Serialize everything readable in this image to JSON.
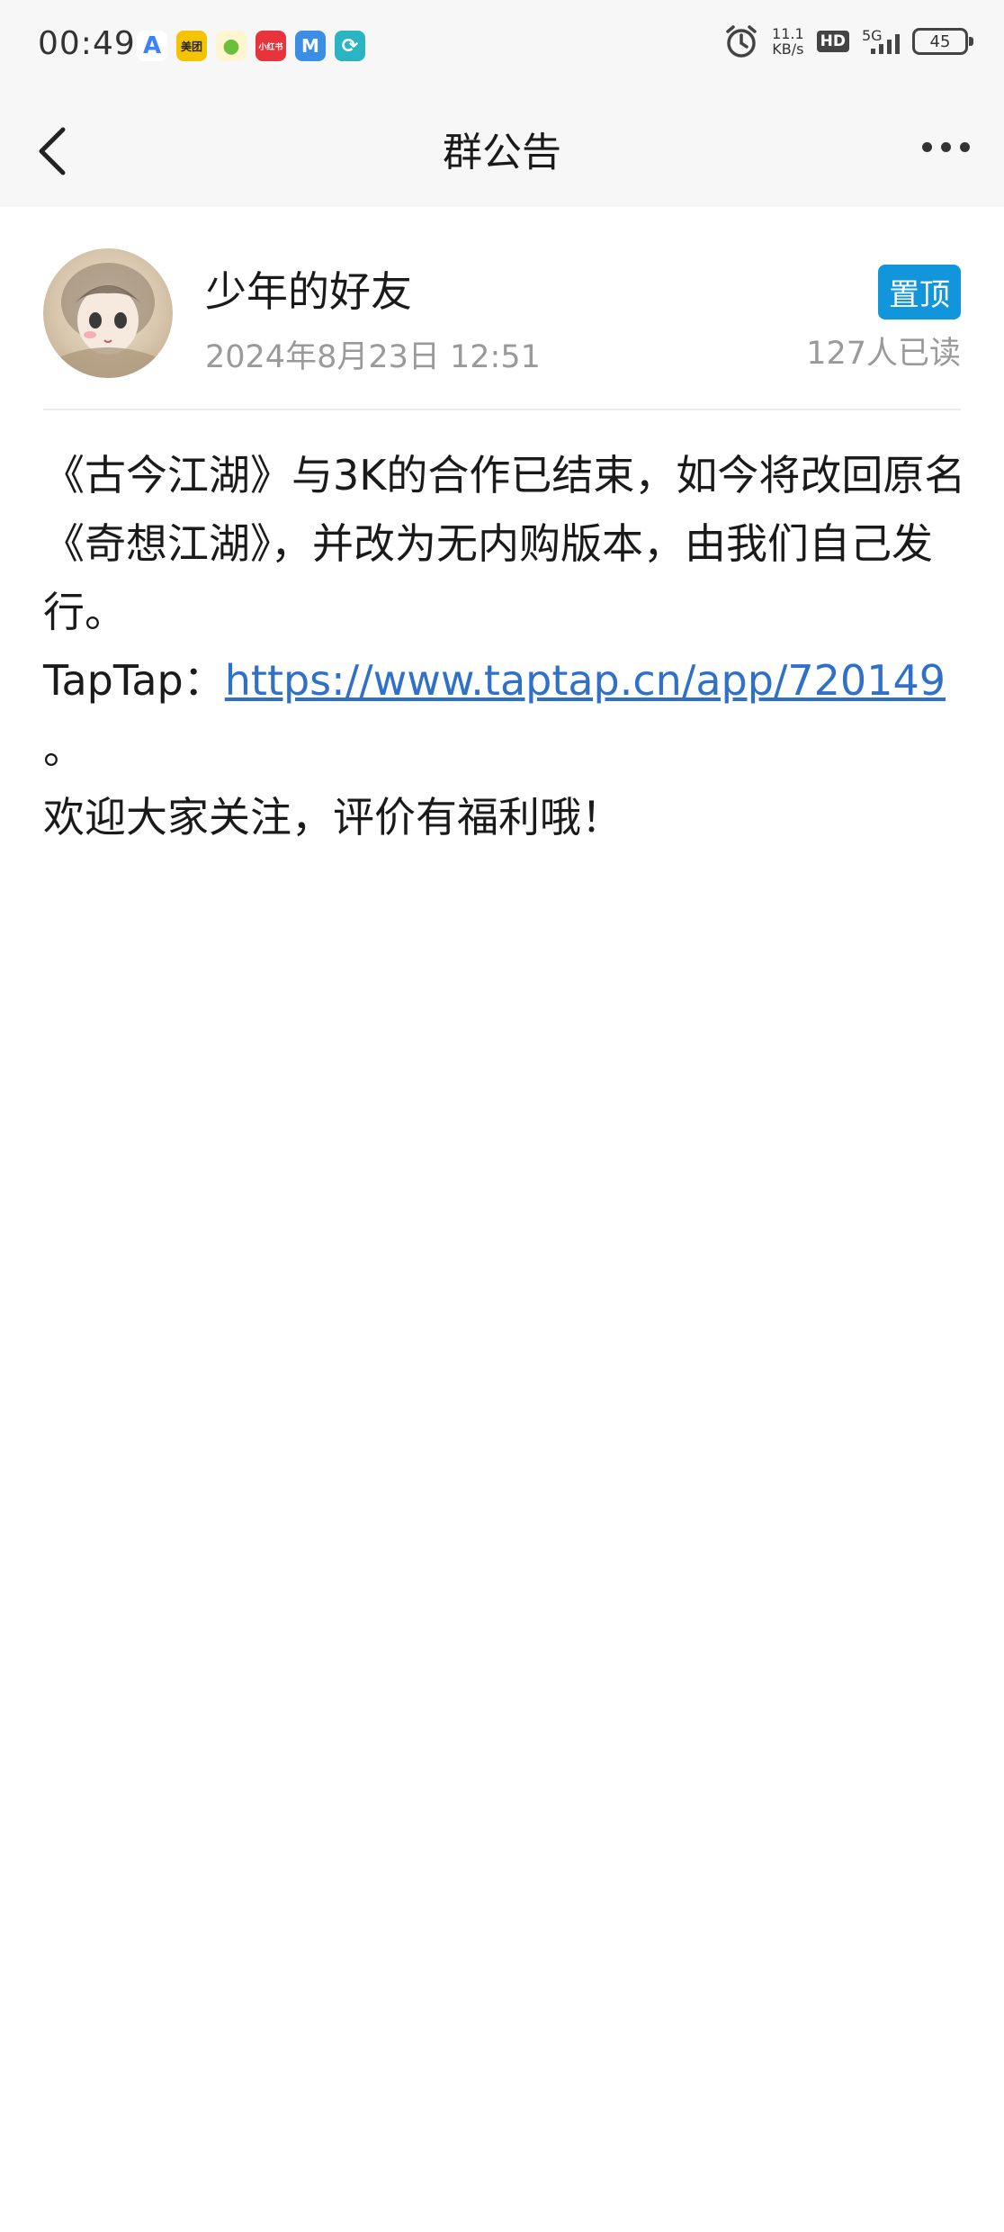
{
  "status": {
    "time": "00:49",
    "speed_value": "11.1",
    "speed_unit": "KB/s",
    "hd": "HD",
    "network": "5G",
    "battery": "45",
    "apps": [
      {
        "name": "app-a-icon",
        "glyph": "A",
        "color": "#3b82f6"
      },
      {
        "name": "meituan-icon",
        "glyph": "美团",
        "color": "#f5c400"
      },
      {
        "name": "app-green-icon",
        "glyph": "●",
        "color": "#f5d75a"
      },
      {
        "name": "xiaohongshu-icon",
        "glyph": "小红书",
        "color": "#e8323c"
      },
      {
        "name": "app-blue-icon",
        "glyph": "M",
        "color": "#3a8ee6"
      },
      {
        "name": "app-teal-icon",
        "glyph": "⟳",
        "color": "#2bb5c4"
      }
    ]
  },
  "navbar": {
    "title": "群公告"
  },
  "announcement": {
    "author": "少年的好友",
    "time": "2024年8月23日 12:51",
    "pin_label": "置顶",
    "read_count": "127人已读",
    "paragraph1": "《古今江湖》与3K的合作已结束，如今将改回原名《奇想江湖》，并改为无内购版本，由我们自己发行。",
    "taptap_prefix": "TapTap：",
    "link": "https://www.taptap.cn/app/720149",
    "link_suffix": "。",
    "paragraph3": "欢迎大家关注，评价有福利哦！"
  }
}
